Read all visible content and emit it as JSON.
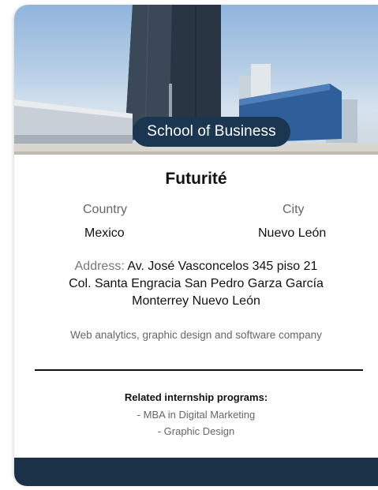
{
  "card": {
    "badge": "School of Business",
    "company_name": "Futurité",
    "country_label": "Country",
    "country_value": "Mexico",
    "city_label": "City",
    "city_value": "Nuevo León",
    "address_label": "Address:",
    "address_line1": "Av. José Vasconcelos 345  piso 21",
    "address_line2": "Col. Santa Engracia San Pedro Garza García",
    "address_line3": "Monterrey Nuevo León",
    "description": "Web analytics, graphic design and software company",
    "programs_title": "Related internship programs:",
    "programs": [
      "- MBA in Digital Marketing",
      "- Graphic Design"
    ]
  },
  "colors": {
    "badge_bg": "#1a3650",
    "footer_bg": "#1b3148"
  }
}
